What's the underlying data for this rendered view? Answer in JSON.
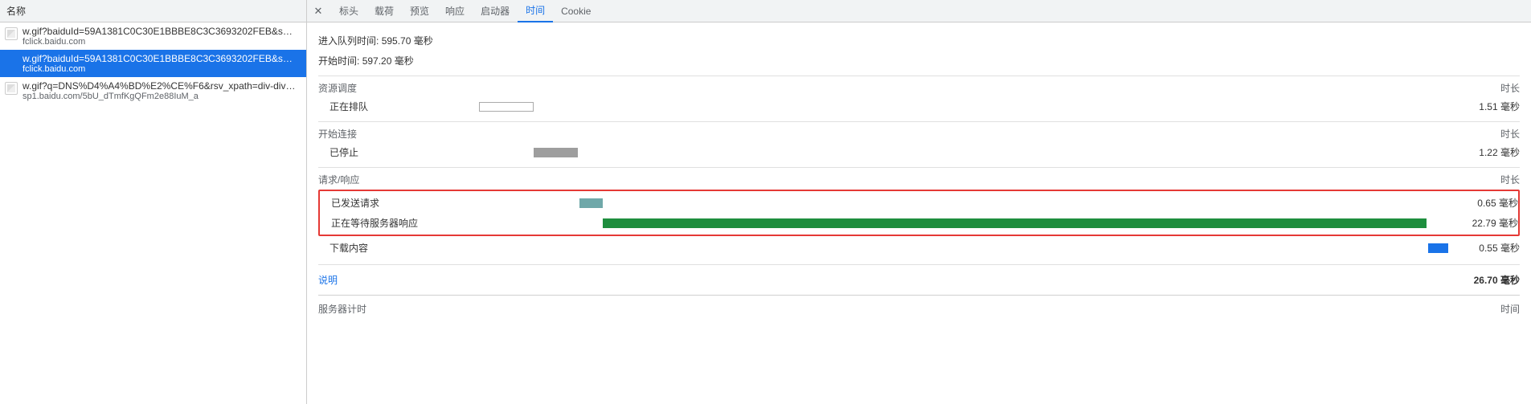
{
  "left": {
    "header": "名称",
    "requests": [
      {
        "name": "w.gif?baiduId=59A1381C0C30E1BBBE8C3C3693202FEB&sea…",
        "domain": "fclick.baidu.com",
        "selected": false,
        "icon": "image"
      },
      {
        "name": "w.gif?baiduId=59A1381C0C30E1BBBE8C3C3693202FEB&sea…",
        "domain": "fclick.baidu.com",
        "selected": true,
        "icon": "none"
      },
      {
        "name": "w.gif?q=DNS%D4%A4%BD%E2%CE%F6&rsv_xpath=div-div-h…",
        "domain": "sp1.baidu.com/5bU_dTmfKgQFm2e88IuM_a",
        "selected": false,
        "icon": "image"
      }
    ]
  },
  "tabs": {
    "items": [
      "标头",
      "载荷",
      "预览",
      "响应",
      "启动器",
      "时间",
      "Cookie"
    ],
    "activeIndex": 5
  },
  "timing": {
    "queued": {
      "label": "进入队列时间:",
      "value": "595.70 毫秒"
    },
    "started": {
      "label": "开始时间:",
      "value": "597.20 毫秒"
    },
    "totalMs": 26.7,
    "sections": [
      {
        "title": "资源调度",
        "durationLabel": "时长",
        "highlighted": false,
        "rows": [
          {
            "label": "正在排队",
            "value": "1.51 毫秒",
            "color": "outline",
            "startMs": 0.0,
            "durMs": 1.51
          }
        ]
      },
      {
        "title": "开始连接",
        "durationLabel": "时长",
        "highlighted": false,
        "rows": [
          {
            "label": "已停止",
            "value": "1.22 毫秒",
            "color": "gray",
            "startMs": 1.51,
            "durMs": 1.22
          }
        ]
      },
      {
        "title": "请求/响应",
        "durationLabel": "时长",
        "highlighted": true,
        "rows": [
          {
            "label": "已发送请求",
            "value": "0.65 毫秒",
            "color": "teal",
            "startMs": 2.73,
            "durMs": 0.65
          },
          {
            "label": "正在等待服务器响应",
            "value": "22.79 毫秒",
            "color": "green",
            "startMs": 3.38,
            "durMs": 22.79
          }
        ]
      },
      {
        "title": null,
        "highlighted": false,
        "nohdr": true,
        "rows": [
          {
            "label": "下载内容",
            "value": "0.55 毫秒",
            "color": "blue",
            "startMs": 26.17,
            "durMs": 0.55
          }
        ]
      }
    ],
    "explainLabel": "说明",
    "totalLabel": "26.70 毫秒",
    "serverTiming": {
      "title": "服务器计时",
      "right": "时间"
    }
  }
}
